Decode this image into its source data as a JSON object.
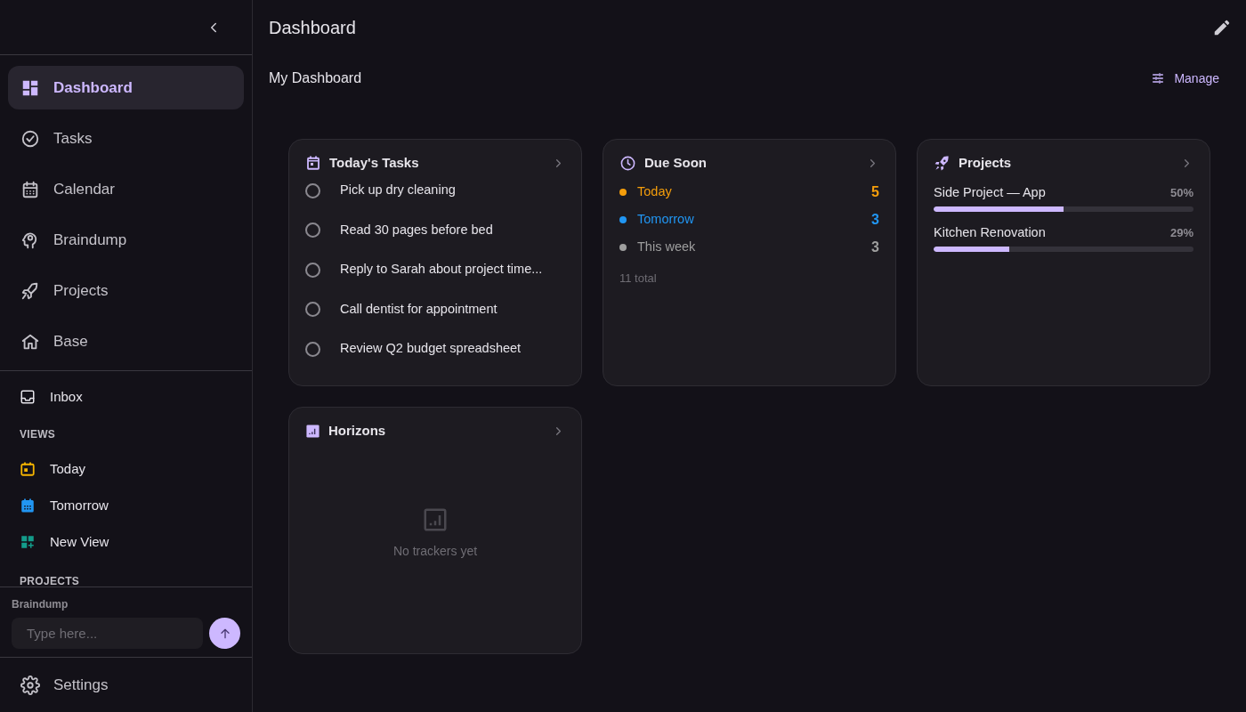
{
  "sidebar": {
    "nav": [
      {
        "label": "Dashboard",
        "selected": true
      },
      {
        "label": "Tasks",
        "selected": false
      },
      {
        "label": "Calendar",
        "selected": false
      },
      {
        "label": "Braindump",
        "selected": false
      },
      {
        "label": "Projects",
        "selected": false
      },
      {
        "label": "Base",
        "selected": false
      }
    ],
    "inbox": {
      "label": "Inbox"
    },
    "views_heading": "VIEWS",
    "views": [
      {
        "label": "Today",
        "color": "#f5b400"
      },
      {
        "label": "Tomorrow",
        "color": "#2196f3"
      },
      {
        "label": "New View",
        "color": "#139c8a"
      }
    ],
    "projects_heading": "PROJECTS",
    "braindump": {
      "label": "Braindump",
      "placeholder": "Type here..."
    },
    "settings": {
      "label": "Settings"
    }
  },
  "header": {
    "title": "Dashboard"
  },
  "subheader": {
    "title": "My Dashboard",
    "manage": "Manage"
  },
  "widgets": [
    {
      "kind": "tasks",
      "title": "Today's Tasks",
      "tasks": [
        {
          "label": "Pick up dry cleaning",
          "checked": false
        },
        {
          "label": "Read 30 pages before bed",
          "checked": false
        },
        {
          "label": "Reply to Sarah about project time...",
          "checked": false
        },
        {
          "label": "Call dentist for appointment",
          "checked": false
        },
        {
          "label": "Review Q2 budget spreadsheet",
          "checked": false
        }
      ]
    },
    {
      "kind": "due",
      "title": "Due Soon",
      "rows": [
        {
          "label": "Today",
          "count": "5",
          "color": "#f59e0b"
        },
        {
          "label": "Tomorrow",
          "count": "3",
          "color": "#2196f3"
        },
        {
          "label": "This week",
          "count": "3",
          "color": "#9e9e9e"
        }
      ],
      "total": "11 total"
    },
    {
      "kind": "projects",
      "title": "Projects",
      "projects": [
        {
          "name": "Side Project — App",
          "percent": "50%",
          "level": 0.5
        },
        {
          "name": "Kitchen Renovation",
          "percent": "29%",
          "level": 0.29
        }
      ]
    },
    {
      "kind": "horizons",
      "title": "Horizons",
      "empty": "No trackers yet"
    }
  ]
}
